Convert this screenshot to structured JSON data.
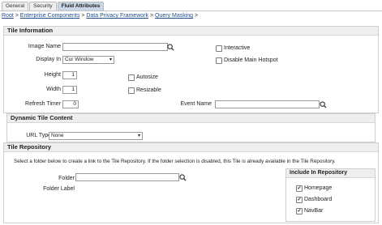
{
  "tabs": [
    {
      "label": "General",
      "active": false
    },
    {
      "label": "Security",
      "active": false
    },
    {
      "label": "Fluid Attributes",
      "active": true
    }
  ],
  "breadcrumb": {
    "items": [
      "Root",
      "Enterprise Components",
      "Data Privacy Framework",
      "Query Masking"
    ],
    "separator": ">"
  },
  "tile_information": {
    "title": "Tile Information",
    "image_name_label": "Image Name",
    "image_name_value": "",
    "display_in_label": "Display In",
    "display_in_value": "Cur Window",
    "interactive_label": "Interactive",
    "interactive_checked": false,
    "disable_hotspot_label": "Disable Main Hotspot",
    "disable_hotspot_checked": false,
    "height_label": "Height",
    "height_value": "1",
    "width_label": "Width",
    "width_value": "1",
    "autosize_label": "Autosize",
    "autosize_checked": false,
    "resizable_label": "Resizable",
    "resizable_checked": false,
    "refresh_timer_label": "Refresh Timer",
    "refresh_timer_value": "0",
    "event_name_label": "Event Name",
    "event_name_value": ""
  },
  "dynamic_tile": {
    "title": "Dynamic Tile Content",
    "url_type_label": "URL Type",
    "url_type_value": "None"
  },
  "tile_repository": {
    "title": "Tile Repository",
    "instructions": "Select a folder below to create a link to the Tile Repository. If the folder selection is disabled, this Tile is already available in the Tile Repository.",
    "folder_label": "Folder",
    "folder_value": "",
    "folder_label_label": "Folder Label",
    "include_title": "Include In Repository",
    "options": [
      {
        "label": "Homepage",
        "checked": true
      },
      {
        "label": "Dashboard",
        "checked": true
      },
      {
        "label": "NavBar",
        "checked": true
      }
    ]
  },
  "colors": {
    "link": "#1f4f8f",
    "active_tab": "#c9d6e6",
    "section_header": "#eeeeee"
  }
}
